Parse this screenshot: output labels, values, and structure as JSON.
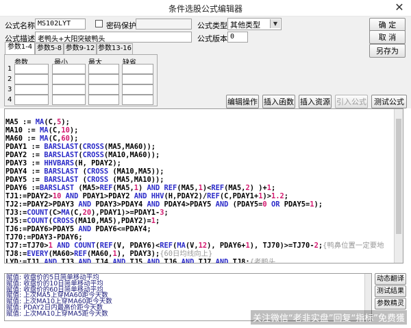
{
  "window": {
    "title": "条件选股公式编辑器",
    "close_glyph": "✕"
  },
  "form": {
    "name_label": "公式名称",
    "name_value": "MS102LYT",
    "password_label": "密码保护",
    "type_label": "公式类型",
    "type_value": "其他类型",
    "desc_label": "公式描述",
    "desc_value": "老鸭头+大阳突破鸭头",
    "version_label": "公式版本",
    "version_value": "0"
  },
  "buttons": {
    "confirm": "确 定",
    "cancel": "取 消",
    "save_as": "另存为",
    "edit_ops": "编辑操作",
    "insert_func": "插入函数",
    "insert_resource": "插入资源",
    "import_formula": "引入公式",
    "test_formula": "测试公式",
    "dynamic_translate": "动态翻译",
    "test_result": "测试结果",
    "param_wizard": "参数精灵"
  },
  "tabs": [
    "参数1-4",
    "参数5-8",
    "参数9-12",
    "参数13-16"
  ],
  "params": {
    "headers": [
      "参数",
      "最小",
      "最大",
      "缺省"
    ],
    "rows": [
      "1",
      "2",
      "3",
      "4"
    ]
  },
  "code_lines": [
    [
      {
        "t": "MA5 := "
      },
      {
        "t": "MA",
        "c": "kw"
      },
      {
        "t": "(C,"
      },
      {
        "t": "5",
        "c": "num"
      },
      {
        "t": ");"
      }
    ],
    [
      {
        "t": "MA10 := "
      },
      {
        "t": "MA",
        "c": "kw"
      },
      {
        "t": "(C,"
      },
      {
        "t": "10",
        "c": "num"
      },
      {
        "t": ");"
      }
    ],
    [
      {
        "t": "MA60 := "
      },
      {
        "t": "MA",
        "c": "kw"
      },
      {
        "t": "(C,"
      },
      {
        "t": "60",
        "c": "num"
      },
      {
        "t": ");"
      }
    ],
    [
      {
        "t": "PDAY1 := "
      },
      {
        "t": "BARSLAST",
        "c": "kw"
      },
      {
        "t": "("
      },
      {
        "t": "CROSS",
        "c": "kw"
      },
      {
        "t": "(MA5,MA60));"
      }
    ],
    [
      {
        "t": "PDAY2 := "
      },
      {
        "t": "BARSLAST",
        "c": "kw"
      },
      {
        "t": "("
      },
      {
        "t": "CROSS",
        "c": "kw"
      },
      {
        "t": "(MA10,MA60));"
      }
    ],
    [
      {
        "t": "PDAY3 := "
      },
      {
        "t": "HHVBARS",
        "c": "kw"
      },
      {
        "t": "(H, PDAY2);"
      }
    ],
    [
      {
        "t": "PDAY4 := "
      },
      {
        "t": "BARSLAST",
        "c": "kw"
      },
      {
        "t": " ("
      },
      {
        "t": "CROSS",
        "c": "kw"
      },
      {
        "t": " (MA10,MA5));"
      }
    ],
    [
      {
        "t": "PDAY5 := "
      },
      {
        "t": "BARSLAST",
        "c": "kw"
      },
      {
        "t": " ("
      },
      {
        "t": "CROSS",
        "c": "kw"
      },
      {
        "t": " (MA5,MA10));"
      }
    ],
    [
      {
        "t": "PDAY6 :="
      },
      {
        "t": "BARSLAST",
        "c": "kw"
      },
      {
        "t": " (MA5>"
      },
      {
        "t": "REF",
        "c": "kw"
      },
      {
        "t": "(MA5,"
      },
      {
        "t": "1",
        "c": "num"
      },
      {
        "t": ") "
      },
      {
        "t": "AND",
        "c": "kw"
      },
      {
        "t": " "
      },
      {
        "t": "REF",
        "c": "kw"
      },
      {
        "t": "(MA5,"
      },
      {
        "t": "1",
        "c": "num"
      },
      {
        "t": ")<"
      },
      {
        "t": "REF",
        "c": "kw"
      },
      {
        "t": "(MA5,"
      },
      {
        "t": "2",
        "c": "num"
      },
      {
        "t": ") )+"
      },
      {
        "t": "1",
        "c": "num"
      },
      {
        "t": ";"
      }
    ],
    [
      {
        "t": "TJ1:=PDAY2>"
      },
      {
        "t": "10",
        "c": "num"
      },
      {
        "t": " "
      },
      {
        "t": "AND",
        "c": "kw"
      },
      {
        "t": " PDAY1>PDAY2 "
      },
      {
        "t": "AND",
        "c": "kw"
      },
      {
        "t": " "
      },
      {
        "t": "HHV",
        "c": "kw"
      },
      {
        "t": "(H,PDAY2)/"
      },
      {
        "t": "REF",
        "c": "kw"
      },
      {
        "t": "(C,PDAY1+"
      },
      {
        "t": "1",
        "c": "num"
      },
      {
        "t": ")>"
      },
      {
        "t": "1.2",
        "c": "num"
      },
      {
        "t": ";"
      }
    ],
    [
      {
        "t": "TJ2:=PDAY2>PDAY3 "
      },
      {
        "t": "AND",
        "c": "kw"
      },
      {
        "t": " PDAY3>PDAY4 "
      },
      {
        "t": "AND",
        "c": "kw"
      },
      {
        "t": " PDAY4>PDAY5 "
      },
      {
        "t": "AND",
        "c": "kw"
      },
      {
        "t": " (PDAY5="
      },
      {
        "t": "0",
        "c": "num"
      },
      {
        "t": " "
      },
      {
        "t": "OR",
        "c": "kw"
      },
      {
        "t": " PDAY5="
      },
      {
        "t": "1",
        "c": "num"
      },
      {
        "t": ");"
      }
    ],
    [
      {
        "t": "TJ3:="
      },
      {
        "t": "COUNT",
        "c": "kw"
      },
      {
        "t": "(C>"
      },
      {
        "t": "MA",
        "c": "kw"
      },
      {
        "t": "(C,"
      },
      {
        "t": "20",
        "c": "num"
      },
      {
        "t": "),PDAY1)>=PDAY1-"
      },
      {
        "t": "3",
        "c": "num"
      },
      {
        "t": ";"
      }
    ],
    [
      {
        "t": "TJ5:="
      },
      {
        "t": "COUNT",
        "c": "kw"
      },
      {
        "t": "("
      },
      {
        "t": "CROSS",
        "c": "kw"
      },
      {
        "t": "(MA10,MA5),PDAY2)="
      },
      {
        "t": "1",
        "c": "num"
      },
      {
        "t": ";"
      }
    ],
    [
      {
        "t": "TJ6:=PDAY6>PDAY5 "
      },
      {
        "t": "AND",
        "c": "kw"
      },
      {
        "t": " PDAY6<=PDAY4;"
      }
    ],
    [
      {
        "t": "TJ70:=PDAY3-PDAY6;"
      }
    ],
    [
      {
        "t": "TJ7:=TJ70>"
      },
      {
        "t": "1",
        "c": "num"
      },
      {
        "t": " "
      },
      {
        "t": "AND",
        "c": "kw"
      },
      {
        "t": " "
      },
      {
        "t": "COUNT",
        "c": "kw"
      },
      {
        "t": "("
      },
      {
        "t": "REF",
        "c": "kw"
      },
      {
        "t": "(V, PDAY6)<"
      },
      {
        "t": "REF",
        "c": "kw"
      },
      {
        "t": "("
      },
      {
        "t": "MA",
        "c": "kw"
      },
      {
        "t": "(V,"
      },
      {
        "t": "12",
        "c": "num"
      },
      {
        "t": "), PDAY6+"
      },
      {
        "t": "1",
        "c": "num"
      },
      {
        "t": "), TJ70)>=TJ70-"
      },
      {
        "t": "2",
        "c": "num"
      },
      {
        "t": ";"
      },
      {
        "t": "{鸭鼻位置一定要地",
        "c": "cm"
      }
    ],
    [
      {
        "t": "TJ8:="
      },
      {
        "t": "EVERY",
        "c": "kw"
      },
      {
        "t": "(MA60>"
      },
      {
        "t": "REF",
        "c": "kw"
      },
      {
        "t": "(MA60,"
      },
      {
        "t": "1",
        "c": "num"
      },
      {
        "t": "), PDAY3);"
      },
      {
        "t": "{60日均线向上}",
        "c": "cm"
      }
    ],
    [
      {
        "t": "LYD:=TJ1 "
      },
      {
        "t": "AND",
        "c": "kw"
      },
      {
        "t": " TJ3 "
      },
      {
        "t": "AND",
        "c": "kw"
      },
      {
        "t": " TJ4 "
      },
      {
        "t": "AND",
        "c": "kw"
      },
      {
        "t": " TJ5 "
      },
      {
        "t": "AND",
        "c": "kw"
      },
      {
        "t": " TJ6 "
      },
      {
        "t": "AND",
        "c": "kw"
      },
      {
        "t": " TJ7 "
      },
      {
        "t": "AND",
        "c": "kw"
      },
      {
        "t": " TJ8:"
      },
      {
        "t": "{老鸭头",
        "c": "cm"
      }
    ]
  ],
  "output_lines": [
    "赋值: 收盘价的5日简单移动平均",
    "赋值: 收盘价的10日简单移动平均",
    "赋值: 收盘价的60日简单移动平均",
    "赋值: 上次MA5上穿MA60距今天数",
    "赋值: 上次MA10上穿MA60距今天数",
    "赋值: PDAY2日内最高价距今天数",
    "赋值: 上次MA10上穿MA5距今天数"
  ],
  "watermark": "关注微信“老韭实盘”回复“指标”免费獲"
}
